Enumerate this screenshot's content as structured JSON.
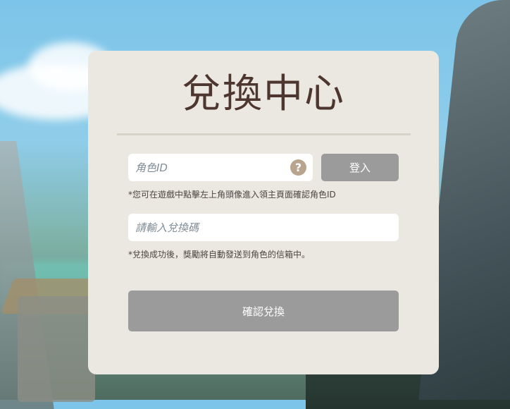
{
  "panel": {
    "title": "兌換中心",
    "role_input_placeholder": "角色ID",
    "help_symbol": "?",
    "login_label": "登入",
    "role_hint": "*您可在遊戲中點擊左上角頭像進入領主頁面確認角色ID",
    "code_input_placeholder": "請輸入兌換碼",
    "code_hint": "*兌換成功後，獎勵將自動發送到角色的信箱中。",
    "confirm_label": "確認兌換"
  },
  "colors": {
    "panel_bg": "#ebe8e1",
    "title": "#4d3630",
    "button": "#9b9b9b",
    "help_icon": "#b9a58e"
  }
}
